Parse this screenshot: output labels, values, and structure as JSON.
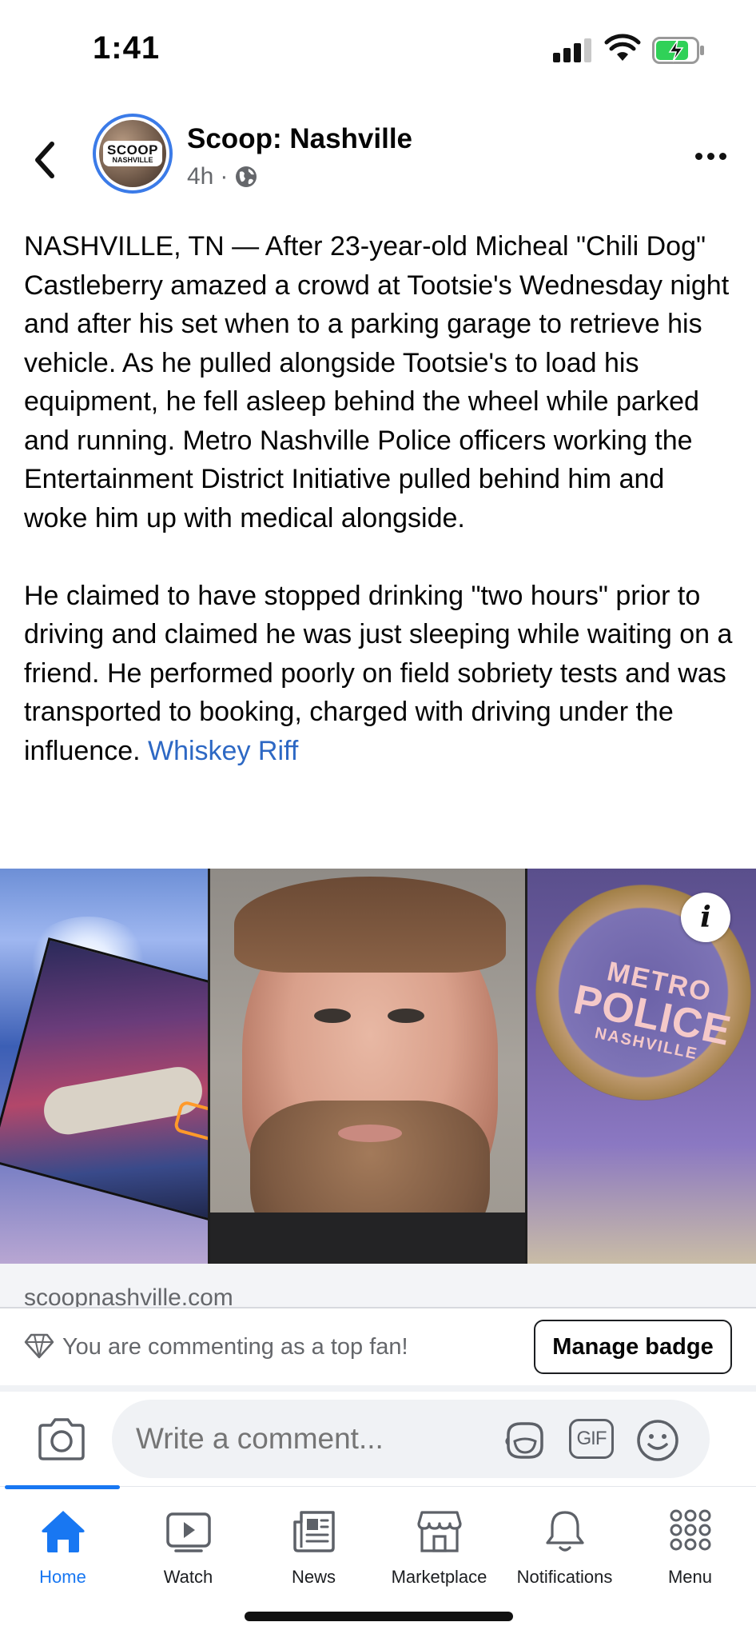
{
  "status_bar": {
    "time": "1:41"
  },
  "post": {
    "page_name": "Scoop: Nashville",
    "avatar_text": [
      "SCOOP",
      "NASHVILLE"
    ],
    "time_ago": "4h",
    "separator": "·",
    "audience_icon": "globe-icon",
    "paragraphs": [
      "NASHVILLE, TN — After 23-year-old Micheal \"Chili Dog\" Castleberry amazed a crowd at Tootsie's Wednesday night and after his set when to a parking garage to retrieve his vehicle. As he pulled alongside Tootsie's to load his equipment, he fell asleep behind the wheel while parked and running. Metro Nashville Police officers working the Entertainment District Initiative pulled behind him and woke him up with medical alongside.",
      "He claimed to have stopped drinking \"two hours\" prior to driving and claimed he was just sleeping while waiting on a friend. He performed poorly on field sobriety tests and was transported to booking, charged with driving under the influence. "
    ],
    "link_text": "Whiskey Riff",
    "image_texts": {
      "badge_top": "METRO",
      "badge_main": "POLICE",
      "badge_sub": "NASHVILLE"
    },
    "info_label": "i",
    "link_domain": "scoopnashville.com"
  },
  "fan_row": {
    "text": "You are commenting as a top fan!",
    "button_label": "Manage badge"
  },
  "comment": {
    "placeholder": "Write a comment...",
    "gif_label": "GIF"
  },
  "tabs": [
    {
      "label": "Home",
      "icon": "home-icon",
      "active": true
    },
    {
      "label": "Watch",
      "icon": "watch-icon",
      "active": false
    },
    {
      "label": "News",
      "icon": "news-icon",
      "active": false
    },
    {
      "label": "Marketplace",
      "icon": "marketplace-icon",
      "active": false
    },
    {
      "label": "Notifications",
      "icon": "bell-icon",
      "active": false
    },
    {
      "label": "Menu",
      "icon": "menu-grid-icon",
      "active": false
    }
  ],
  "colors": {
    "accent": "#1877f2",
    "link": "#2d68c4",
    "secondary_text": "#65676b",
    "battery": "#30d158"
  }
}
